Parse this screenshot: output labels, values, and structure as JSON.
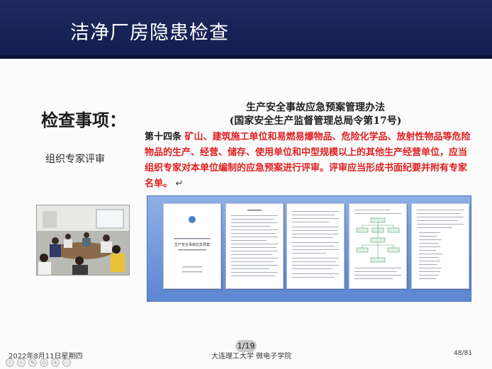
{
  "slide": {
    "title": "洁净厂房隐患检查",
    "section_label": "检查事项：",
    "sub_label": "组织专家评审",
    "doc_title_line1": "生产安全事故应急预案管理办法",
    "doc_title_line2": "(国家安全生产监督管理总局令第17号)",
    "clause_number": "第十四条",
    "clause_text": "矿山、建筑施工单位和易燃易爆物品、危险化学品、放射性物品等危险物品的生产、经营、储存、使用单位和中型规模以上的其他生产经营单位，应当组织专家对本单位编制的应急预案进行评审。评审应当形成书面纪要并附有专家名单。",
    "clause_end_mark": "↵"
  },
  "document_pages": {
    "cover_title": "生产安全事故应急预案"
  },
  "footer": {
    "date": "2022年8月11日星期四",
    "school": "大连理工大学 微电子学院",
    "page": "48/81"
  },
  "viewer": {
    "page_counter": "1/19"
  },
  "toolbar": {
    "icons": [
      "back-icon",
      "forward-icon",
      "pen-icon",
      "eraser-icon",
      "zoom-icon",
      "more-icon"
    ]
  },
  "colors": {
    "header_bg": "#1f2a63",
    "clause_text": "#e02020",
    "panel_bg": "#6f95dc"
  }
}
